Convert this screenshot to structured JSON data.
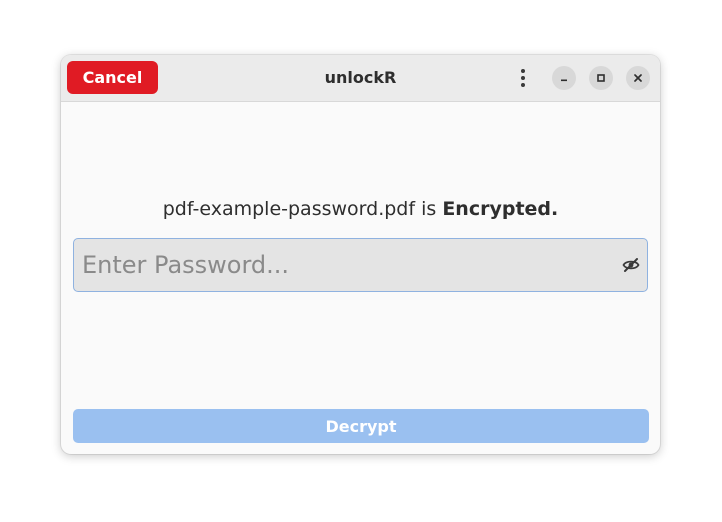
{
  "window": {
    "title": "unlockR",
    "cancel_label": "Cancel"
  },
  "header_icons": {
    "menu": "vertical-ellipsis-icon",
    "minimize": "minimize-icon",
    "maximize": "maximize-icon",
    "close": "close-icon"
  },
  "status": {
    "filename": "pdf-example-password.pdf",
    "verb": " is ",
    "state": "Encrypted."
  },
  "password": {
    "value": "",
    "placeholder": "Enter Password...",
    "toggle_icon": "eye-hidden-icon"
  },
  "actions": {
    "decrypt_label": "Decrypt"
  },
  "colors": {
    "cancel_bg": "#e01b24",
    "decrypt_bg": "#9ac0f0",
    "field_border": "#8fb2e0",
    "titlebar_bg": "#ebebeb"
  }
}
